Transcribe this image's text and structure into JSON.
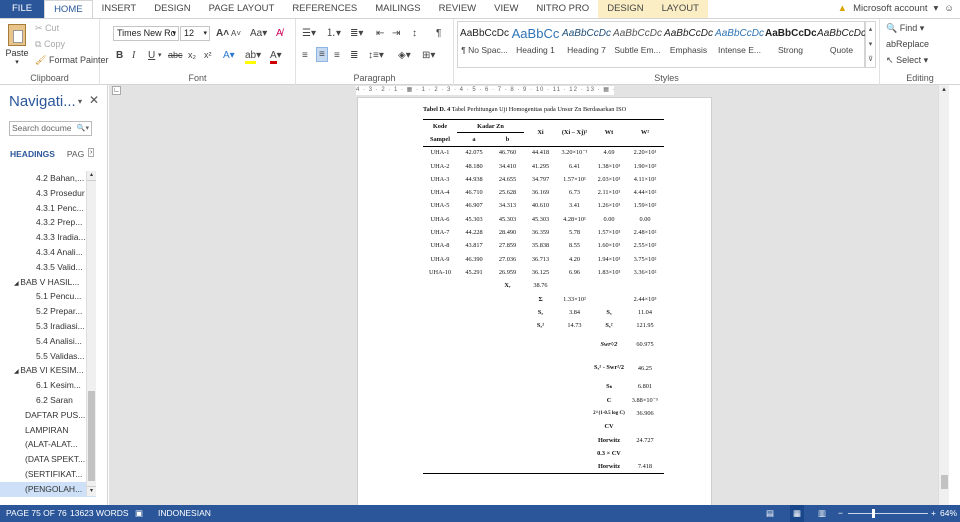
{
  "tabs": [
    "FILE",
    "HOME",
    "INSERT",
    "DESIGN",
    "PAGE LAYOUT",
    "REFERENCES",
    "MAILINGS",
    "REVIEW",
    "VIEW",
    "NITRO PRO",
    "DESIGN",
    "LAYOUT"
  ],
  "account": "Microsoft account",
  "clipboard": {
    "paste": "Paste",
    "cut": "Cut",
    "copy": "Copy",
    "format_painter": "Format Painter",
    "label": "Clipboard"
  },
  "font": {
    "name": "Times New Ro",
    "size": "12",
    "label": "Font",
    "grow": "A",
    "shrink": "A",
    "case": "Aa",
    "bold": "B",
    "italic": "I",
    "underline": "U",
    "strike": "abc",
    "sub": "x₂",
    "sup": "x²"
  },
  "paragraph": {
    "label": "Paragraph",
    "pilcrow": "¶"
  },
  "styles": {
    "label": "Styles",
    "items": [
      {
        "preview": "AaBbCcDc",
        "name": "¶ No Spac..."
      },
      {
        "preview": "AaBbCc",
        "name": "Heading 1"
      },
      {
        "preview": "AaBbCcDc",
        "name": "Heading 7"
      },
      {
        "preview": "AaBbCcDc",
        "name": "Subtle Em..."
      },
      {
        "preview": "AaBbCcDc",
        "name": "Emphasis"
      },
      {
        "preview": "AaBbCcDc",
        "name": "Intense E..."
      },
      {
        "preview": "AaBbCcDc",
        "name": "Strong"
      },
      {
        "preview": "AaBbCcDc",
        "name": "Quote"
      }
    ]
  },
  "editing": {
    "find": "Find",
    "replace": "Replace",
    "select": "Select",
    "label": "Editing"
  },
  "nav": {
    "title": "Navigati...",
    "search_placeholder": "Search docume",
    "tab_headings": "HEADINGS",
    "tab_pages": "PAG",
    "items": [
      "4.2 Bahan,...",
      "4.3 Prosedur",
      "4.3.1 Penc...",
      "4.3.2 Prep...",
      "4.3.3 Iradia...",
      "4.3.4 Anali...",
      "4.3.5 Valid...",
      "BAB V HASIL...",
      "5.1 Pencu...",
      "5.2 Prepar...",
      "5.3 Iradiasi...",
      "5.4 Analisi...",
      "5.5 Validas...",
      "BAB VI KESIM...",
      "6.1 Kesim...",
      "6.2 Saran",
      "DAFTAR PUS...",
      "LAMPIRAN",
      "(ALAT-ALAT...",
      "(DATA SPEKT...",
      "(SERTIFIKAT...",
      "(PENGOLAH..."
    ]
  },
  "ruler_text": "4 · 3 · 2 · 1 · ▦ · 1 · 2 · 3 · 4 · 5 · 6 · 7 · 8 · 9 · 10 · 11 · 12 · 13 · ▦ · 15 · 16",
  "doc": {
    "caption_bold": "Tabel D. 4",
    "caption_rest": " Tabel Perhitungan Uji Homogenitas pada Unsur Zn Berdasarkan ISO",
    "header": {
      "kode": "Kode",
      "sampel": "Sampel",
      "kadar": "Kadar Zn",
      "a": "a",
      "b": "b",
      "xi": "Xi",
      "xixj": "(Xi – Xj)²",
      "wt": "Wt",
      "w2": "W²"
    },
    "rows": [
      [
        "UHA-1",
        "42.075",
        "46.760",
        "44.418",
        "3.20×10⁻¹",
        "4.69",
        "2.20×10¹"
      ],
      [
        "UHA-2",
        "48.180",
        "34.410",
        "41.295",
        "6.41",
        "1.38×10¹",
        "1.90×10²"
      ],
      [
        "UHA-3",
        "44.938",
        "24.655",
        "34.797",
        "1.57×10¹",
        "2.03×10¹",
        "4.11×10²"
      ],
      [
        "UHA-4",
        "46.710",
        "25.628",
        "36.169",
        "6.73",
        "2.11×10¹",
        "4.44×10²"
      ],
      [
        "UHA-5",
        "46.907",
        "34.313",
        "40.610",
        "3.41",
        "1.26×10¹",
        "1.59×10²"
      ],
      [
        "UHA-6",
        "45.303",
        "45.303",
        "45.303",
        "4.28×10¹",
        "0.00",
        "0.00"
      ],
      [
        "UHA-7",
        "44.228",
        "28.490",
        "36.359",
        "5.78",
        "1.57×10¹",
        "2.48×10²"
      ],
      [
        "UHA-8",
        "43.817",
        "27.859",
        "35.838",
        "8.55",
        "1.60×10¹",
        "2.55×10²"
      ],
      [
        "UHA-9",
        "46.390",
        "27.036",
        "36.713",
        "4.20",
        "1.94×10¹",
        "3.75×10²"
      ],
      [
        "UHA-10",
        "45.291",
        "26.959",
        "36.125",
        "6.96",
        "1.83×10¹",
        "3.36×10²"
      ]
    ],
    "xr_label": "Xᵣ",
    "xr_value": "38.76",
    "sum_label": "Σ",
    "sum_xixj": "1.33×10²",
    "sum_w2": "2.44×10³",
    "sx_label": "Sₓ",
    "sx_value": "3.84",
    "sw_label": "Sₓ",
    "sw_value": "11.04",
    "sx2_label": "Sₓ²",
    "sx2_value": "14.73",
    "sw2_label": "Sₓ²",
    "sw2_value": "121.95",
    "swr_label": "Swr²/2",
    "swr_value": "60.975",
    "diff_label": "Sₓ² - Swr²/2",
    "diff_value": "46.25",
    "ss_label": "Sₛ",
    "ss_value": "6.801",
    "c_label": "C",
    "c_value": "3.88×10⁻⁵",
    "hor_label": "2^(1-0.5 log C)",
    "hor_value": "36.906",
    "cv_label": "CV",
    "horwitz_label": "Horwitz",
    "horwitz_value": "24.727",
    "cv3_label": "0.3 × CV",
    "horwitz2_label": "Horwitz",
    "horwitz2_value": "7.418"
  },
  "status": {
    "page": "PAGE 75 OF 76",
    "words": "13623 WORDS",
    "language": "INDONESIAN",
    "zoom": "64%"
  }
}
